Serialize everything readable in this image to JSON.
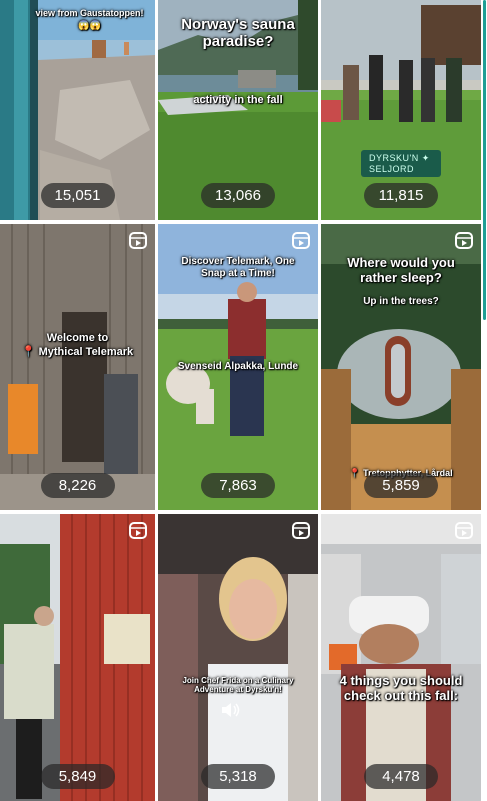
{
  "tiles": [
    {
      "count": "15,051",
      "text1": "view from Gaustatoppen!",
      "emoji": "😱😱"
    },
    {
      "count": "13,066",
      "text1": "Norway's sauna paradise?",
      "text2": "activity in the fall"
    },
    {
      "count": "11,815",
      "badge": "DYRSKU'N ✦ SELJORD"
    },
    {
      "count": "8,226",
      "text1": "Welcome to",
      "text2": "📍 Mythical Telemark"
    },
    {
      "count": "7,863",
      "text1": "Discover Telemark, One Snap at a Time!",
      "text2": "Svenseid Alpakka, Lunde"
    },
    {
      "count": "5,859",
      "text1": "Where would you rather sleep?",
      "text2": "Up in the trees?",
      "text3": "📍 Tretopphytter, Lårdal"
    },
    {
      "count": "5,849"
    },
    {
      "count": "5,318",
      "text1": "Join Chef Frida on a Culinary Adventure at Dyrsku'n!"
    },
    {
      "count": "4,478",
      "text1": "4 things you should check out this fall:"
    }
  ],
  "icons": {
    "reel": "reel-icon",
    "sound": "sound-icon"
  },
  "colors": {
    "accent": "#1f9e95"
  }
}
